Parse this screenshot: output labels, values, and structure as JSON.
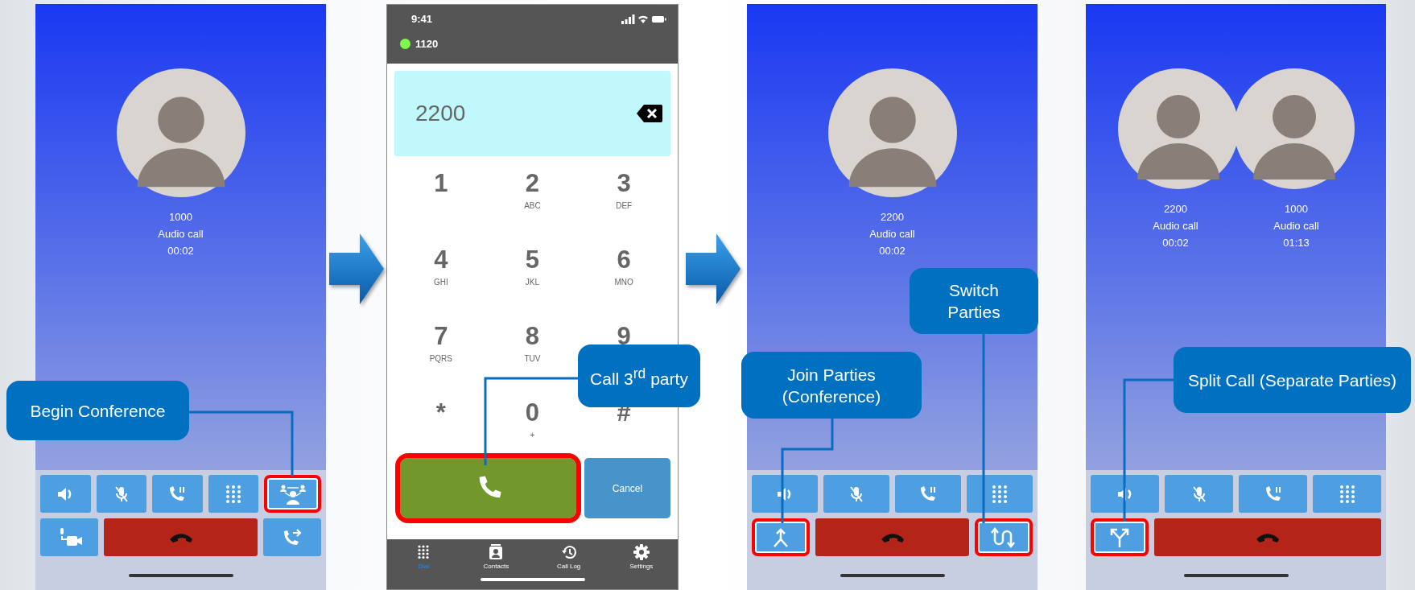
{
  "screens": [
    {
      "kind": "call",
      "parties": [
        {
          "number": "1000",
          "call_type": "Audio call",
          "duration": "00:02"
        }
      ],
      "button_rows": [
        {
          "buttons": [
            {
              "kind": "speaker",
              "highlighted": false
            },
            {
              "kind": "mute",
              "highlighted": false
            },
            {
              "kind": "hold",
              "highlighted": false
            },
            {
              "kind": "keypad",
              "highlighted": false
            },
            {
              "kind": "conference",
              "highlighted": true
            }
          ]
        },
        {
          "buttons": [
            {
              "kind": "video",
              "highlighted": false
            },
            {
              "kind": "hangup",
              "highlighted": false
            },
            {
              "kind": "transfer",
              "highlighted": false
            }
          ]
        }
      ]
    },
    {
      "kind": "dialer",
      "status_bar": {
        "time": "9:41"
      },
      "account": {
        "number": "1120",
        "online": true
      },
      "number_field": {
        "value": "2200"
      },
      "keys": [
        {
          "digit": "1"
        },
        {
          "digit": "2",
          "letters": "ABC"
        },
        {
          "digit": "3",
          "letters": "DEF"
        },
        {
          "digit": "4",
          "letters": "GHI"
        },
        {
          "digit": "5",
          "letters": "JKL"
        },
        {
          "digit": "6",
          "letters": "MNO"
        },
        {
          "digit": "7",
          "letters": "PQRS"
        },
        {
          "digit": "8",
          "letters": "TUV"
        },
        {
          "digit": "9"
        },
        {
          "digit": "*"
        },
        {
          "digit": "0",
          "letters": "+"
        },
        {
          "digit": "#"
        }
      ],
      "call_button": {
        "highlighted": true
      },
      "cancel_button": {
        "label": "Cancel"
      },
      "tabs": [
        {
          "label": "Dial",
          "kind": "keypad",
          "selected": true
        },
        {
          "label": "Contacts",
          "kind": "contacts",
          "selected": false
        },
        {
          "label": "Call Log",
          "kind": "history",
          "selected": false
        },
        {
          "label": "Settings",
          "kind": "settings",
          "selected": false
        }
      ]
    },
    {
      "kind": "call",
      "parties": [
        {
          "number": "2200",
          "call_type": "Audio call",
          "duration": "00:02"
        }
      ],
      "button_rows": [
        {
          "buttons": [
            {
              "kind": "speaker",
              "highlighted": false
            },
            {
              "kind": "mute",
              "highlighted": false
            },
            {
              "kind": "hold",
              "highlighted": false
            },
            {
              "kind": "keypad",
              "highlighted": false
            }
          ]
        },
        {
          "buttons": [
            {
              "kind": "merge",
              "highlighted": true
            },
            {
              "kind": "hangup",
              "highlighted": false
            },
            {
              "kind": "swap",
              "highlighted": true
            }
          ]
        }
      ]
    },
    {
      "kind": "call",
      "parties": [
        {
          "number": "2200",
          "call_type": "Audio call",
          "duration": "00:02"
        },
        {
          "number": "1000",
          "call_type": "Audio call",
          "duration": "01:13"
        }
      ],
      "button_rows": [
        {
          "buttons": [
            {
              "kind": "speaker",
              "highlighted": false
            },
            {
              "kind": "mute",
              "highlighted": false
            },
            {
              "kind": "hold",
              "highlighted": false
            },
            {
              "kind": "keypad",
              "highlighted": false
            }
          ]
        },
        {
          "buttons": [
            {
              "kind": "split",
              "highlighted": true
            },
            {
              "kind": "hangup",
              "highlighted": false
            }
          ]
        }
      ]
    }
  ],
  "callouts": [
    {
      "text": "Begin Conference"
    },
    {
      "text": "Call 3$^{rd}$ party"
    },
    {
      "text": "Switch Parties"
    },
    {
      "text": "Join Parties (Conference)"
    },
    {
      "text": "Split Call (Separate Parties)"
    }
  ]
}
